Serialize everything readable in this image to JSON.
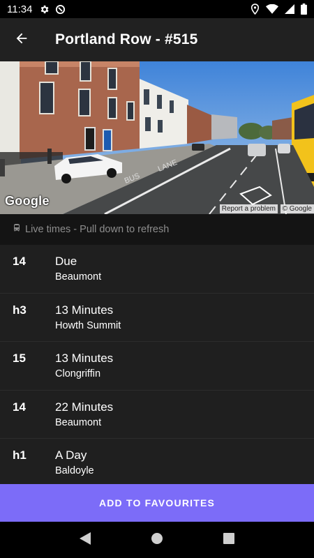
{
  "status_bar": {
    "time": "11:34",
    "left_icons": [
      "gear-icon",
      "circle-slash-icon"
    ],
    "right_icons": [
      "location-pin-icon",
      "wifi-icon",
      "signal-icon",
      "battery-icon"
    ]
  },
  "app_bar": {
    "title": "Portland Row - #515",
    "back_icon": "arrow-left-icon"
  },
  "street_view": {
    "logo": "Google",
    "report_label": "Report a problem",
    "copyright": "© Google"
  },
  "live_bar": {
    "icon": "bus-icon",
    "text": "Live times - Pull down to refresh"
  },
  "departures": [
    {
      "route": "14",
      "time": "Due",
      "destination": "Beaumont"
    },
    {
      "route": "h3",
      "time": "13 Minutes",
      "destination": "Howth Summit"
    },
    {
      "route": "15",
      "time": "13 Minutes",
      "destination": "Clongriffin"
    },
    {
      "route": "14",
      "time": "22 Minutes",
      "destination": "Beaumont"
    },
    {
      "route": "h1",
      "time": "A Day",
      "destination": "Baldoyle"
    }
  ],
  "favourite_button": {
    "label": "ADD TO FAVOURITES",
    "color": "#7c6cf8"
  },
  "nav_bar": {
    "icons": [
      "back-triangle-icon",
      "home-circle-icon",
      "recents-square-icon"
    ]
  },
  "colors": {
    "background": "#1f1f1f",
    "app_bar": "#212121",
    "live_bar": "#141414",
    "accent": "#7c6cf8"
  }
}
